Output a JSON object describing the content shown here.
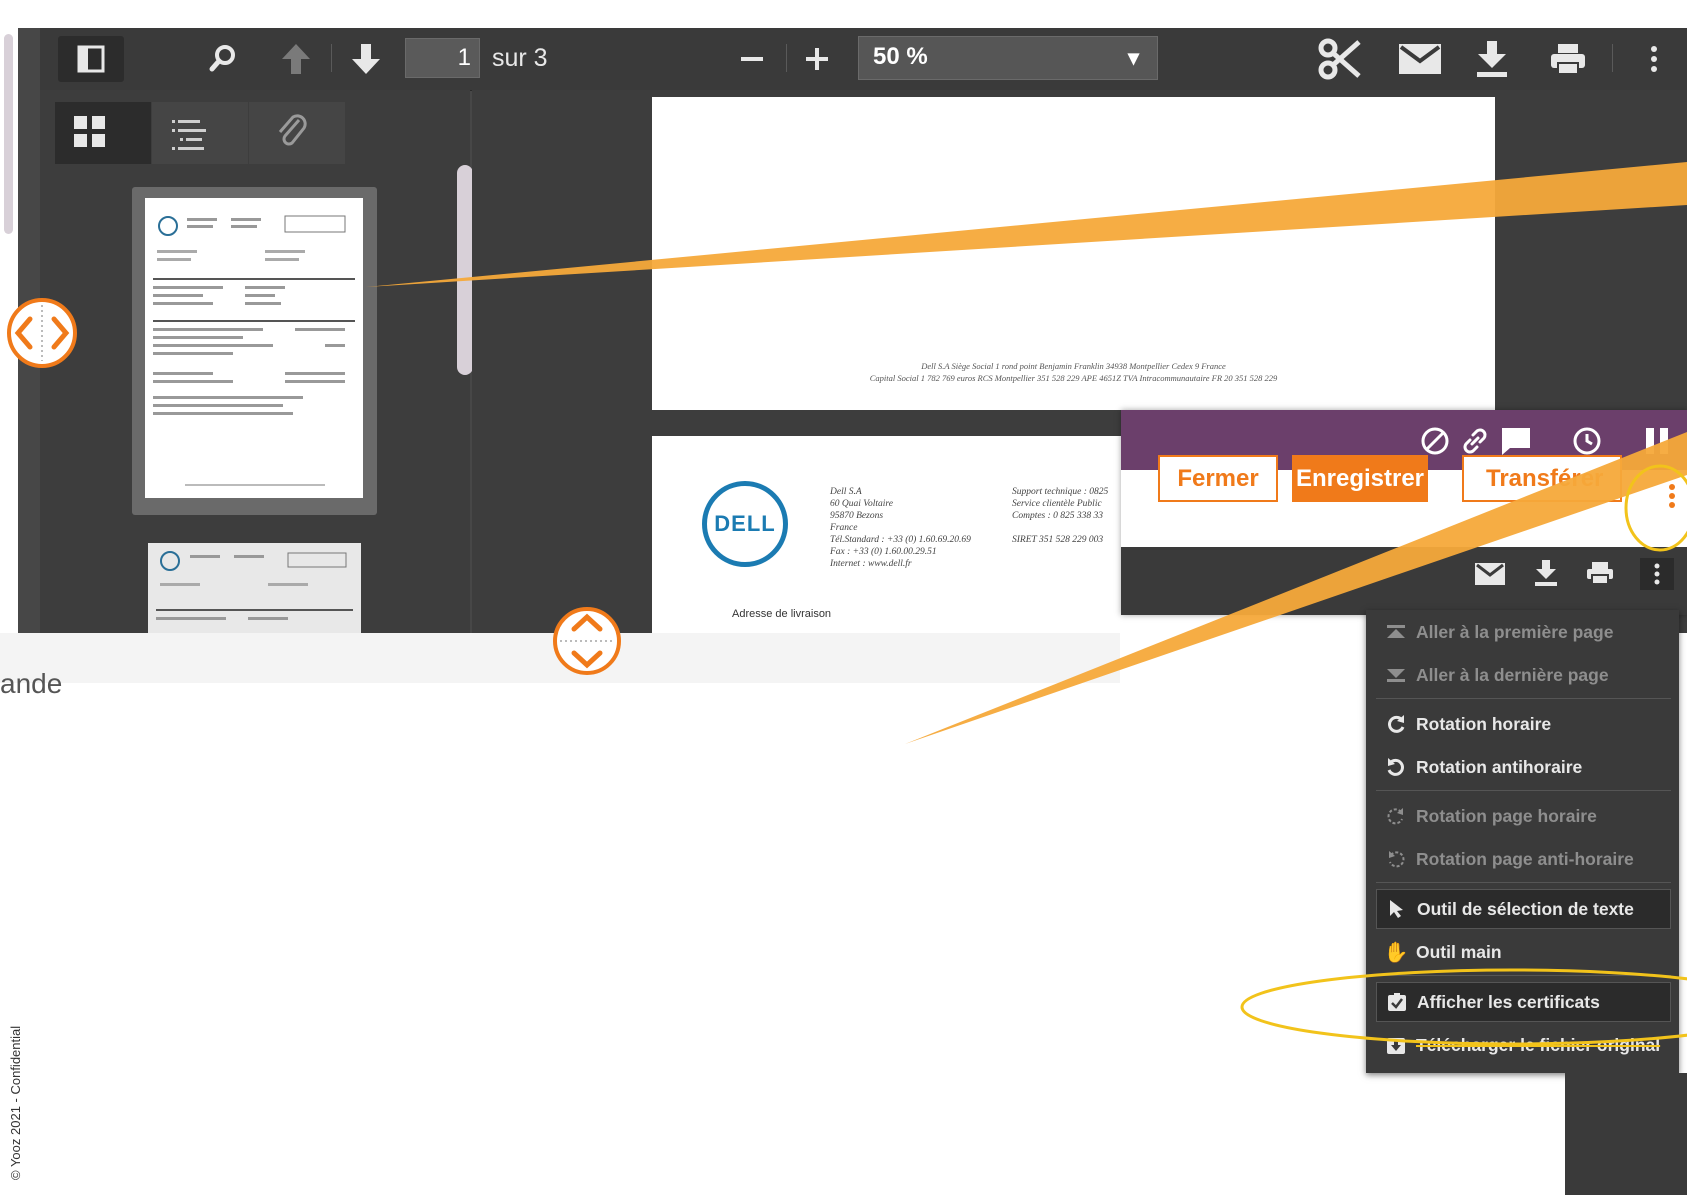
{
  "toolbar": {
    "page_number": "1",
    "page_total": "sur 3",
    "zoom_value": "50 %"
  },
  "document": {
    "page1_footer_line1": "Dell S.A Siège Social 1 rond point Benjamin Franklin 34938 Montpellier Cedex 9  France",
    "page1_footer_line2": "Capital Social 1 782 769 euros  RCS Montpellier 351 528 229  APE 4651Z  TVA Intracommunautaire FR 20 351 528 229",
    "dell_logo_text": "DELL",
    "company_block": [
      "Dell S.A",
      "60 Quai Voltaire",
      "95870 Bezons",
      "France",
      "Tél.Standard : +33 (0) 1.60.69.20.69",
      "Fax : +33 (0) 1.60.00.29.51",
      "Internet : www.dell.fr"
    ],
    "support_block": [
      "Support technique : 0825",
      "Service clientèle Public",
      "Comptes : 0 825 338 33",
      "",
      "SIRET 351 528 229 003"
    ],
    "shipping_address_label": "Adresse de livraison"
  },
  "bottom_text": "ande",
  "overlay": {
    "close_label": "Fermer",
    "save_label": "Enregistrer",
    "transfer_label": "Transférer"
  },
  "menu": {
    "items": [
      {
        "label": "Aller à la première page",
        "icon": "first-page-icon",
        "disabled": true
      },
      {
        "label": "Aller à la dernière page",
        "icon": "last-page-icon",
        "disabled": true
      },
      {
        "label": "Rotation horaire",
        "icon": "rotate-cw-icon",
        "disabled": false
      },
      {
        "label": "Rotation antihoraire",
        "icon": "rotate-ccw-icon",
        "disabled": false
      },
      {
        "label": "Rotation page horaire",
        "icon": "rotate-page-cw-icon",
        "disabled": true
      },
      {
        "label": "Rotation page anti-horaire",
        "icon": "rotate-page-ccw-icon",
        "disabled": true
      },
      {
        "label": "Outil de sélection de texte",
        "icon": "cursor-icon",
        "disabled": false
      },
      {
        "label": "Outil main",
        "icon": "hand-icon",
        "disabled": false
      },
      {
        "label": "Afficher les certificats",
        "icon": "certificate-icon",
        "disabled": false
      },
      {
        "label": "Télécharger le fichier original",
        "icon": "download-original-icon",
        "disabled": false
      }
    ]
  },
  "footer": {
    "confidential": "© Yooz 2021 - Confidential"
  },
  "colors": {
    "accent_orange": "#f07a1a",
    "callout_orange": "#f5a93a",
    "highlight_yellow": "#f2c31b",
    "purple_bar": "#6b3f6b",
    "viewer_dark": "#3a3a3a"
  }
}
